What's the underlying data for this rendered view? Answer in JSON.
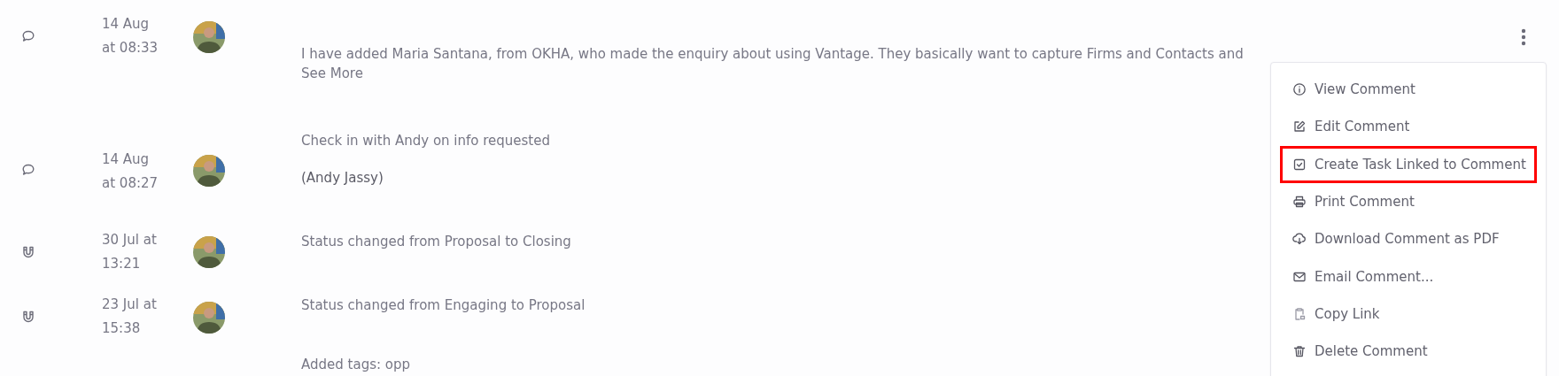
{
  "entries": [
    {
      "kind": "comment",
      "date": [
        "14 Aug",
        "at 08:33"
      ],
      "lines": [
        "I have added Maria Santana, from OKHA, who made the enquiry about using Vantage. They basically want to capture Firms and Contacts and",
        "See More"
      ],
      "has_menu": true
    },
    {
      "kind": "comment",
      "date": [
        "14 Aug",
        "at 08:27"
      ],
      "lines": [
        "Check in with Andy on info requested",
        "(Andy Jassy)"
      ],
      "has_menu": false
    },
    {
      "kind": "status",
      "date": [
        "30 Jul at",
        "13:21"
      ],
      "lines": [
        "Status changed from Proposal to Closing"
      ],
      "has_menu": false
    },
    {
      "kind": "status",
      "date": [
        "23 Jul at",
        "15:38"
      ],
      "lines": [
        "Status changed from Engaging to Proposal"
      ],
      "has_menu": false
    },
    {
      "kind": "none",
      "lines": [
        "Added tags: opp"
      ]
    }
  ],
  "menu": [
    {
      "label": "View Comment",
      "highlighted": false
    },
    {
      "label": "Edit Comment",
      "highlighted": false
    },
    {
      "label": "Create Task Linked to Comment",
      "highlighted": true
    },
    {
      "label": "Print Comment",
      "highlighted": false
    },
    {
      "label": "Download Comment as PDF",
      "highlighted": false
    },
    {
      "label": "Email Comment...",
      "highlighted": false
    },
    {
      "label": "Copy Link",
      "highlighted": false
    },
    {
      "label": "Delete Comment",
      "highlighted": false
    }
  ]
}
